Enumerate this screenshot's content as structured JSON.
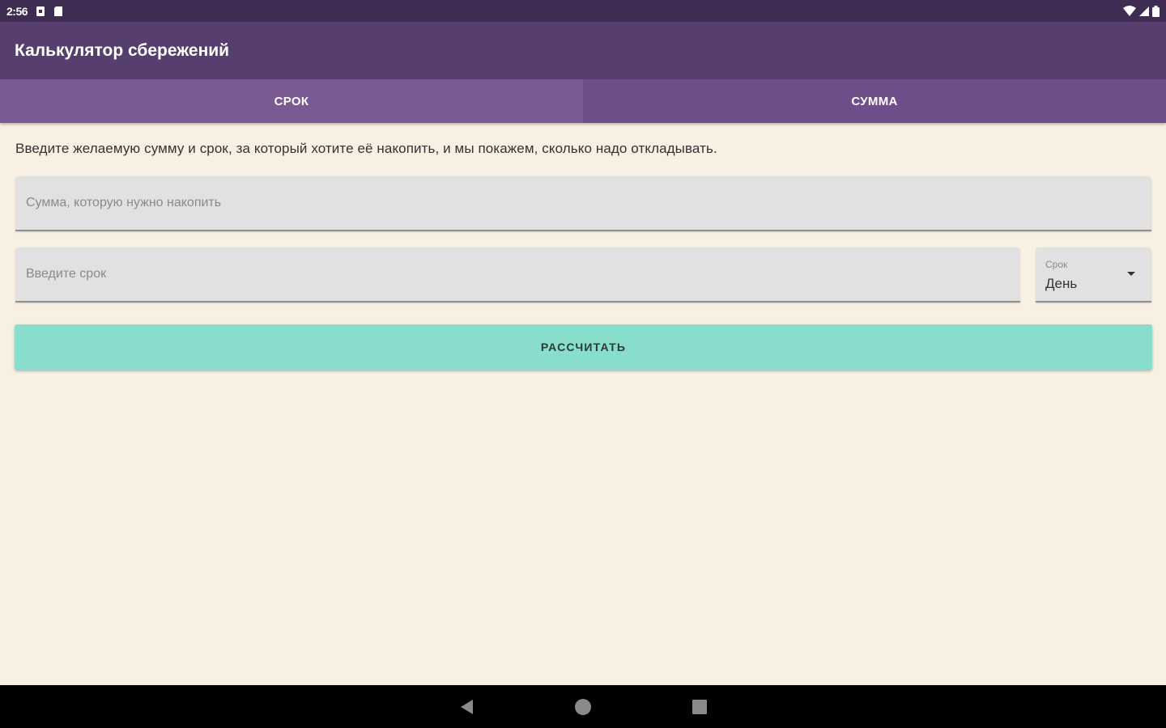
{
  "status_bar": {
    "time": "2:56",
    "icons": [
      "sim-card-icon",
      "sd-card-icon",
      "wifi-icon",
      "cell-signal-icon",
      "battery-icon"
    ]
  },
  "app_bar": {
    "title": "Калькулятор сбережений"
  },
  "tabs": [
    {
      "label": "СРОК",
      "active": true
    },
    {
      "label": "СУММА",
      "active": false
    }
  ],
  "main": {
    "description": "Введите желаемую сумму и срок, за который хотите её накопить, и мы покажем, сколько надо откладывать.",
    "amount_field": {
      "placeholder": "Сумма, которую нужно накопить",
      "value": ""
    },
    "term_field": {
      "placeholder": "Введите срок",
      "value": ""
    },
    "period_select": {
      "label": "Срок",
      "value": "День"
    },
    "calculate_label": "РАССЧИТАТЬ"
  },
  "nav_bar": {
    "buttons": [
      "back-icon",
      "home-icon",
      "recents-icon"
    ]
  },
  "colors": {
    "status_bar": "#3e2c52",
    "app_bar": "#563f6f",
    "tab_active": "#795a93",
    "tab_inactive": "#6e4f8a",
    "background": "#f7f0e3",
    "button": "#89ddcc"
  }
}
